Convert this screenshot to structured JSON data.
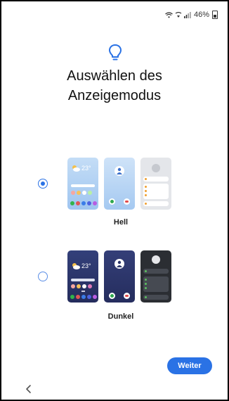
{
  "status_bar": {
    "battery_percent": "46%",
    "icons": [
      "wifi-icon",
      "call-wifi-icon",
      "signal-icon",
      "battery-icon"
    ]
  },
  "header": {
    "icon": "lightbulb-icon",
    "title_line1": "Auswählen des",
    "title_line2": "Anzeigemodus"
  },
  "modes": {
    "light": {
      "label": "Hell",
      "selected": true,
      "preview_temp": "23°"
    },
    "dark": {
      "label": "Dunkel",
      "selected": false,
      "preview_temp": "23°"
    }
  },
  "footer": {
    "next_label": "Weiter",
    "back_icon": "chevron-left-icon"
  },
  "colors": {
    "accent": "#2a72e5",
    "light_preview_bg": "#a9cdf4",
    "dark_preview_bg": "#2a3569"
  }
}
